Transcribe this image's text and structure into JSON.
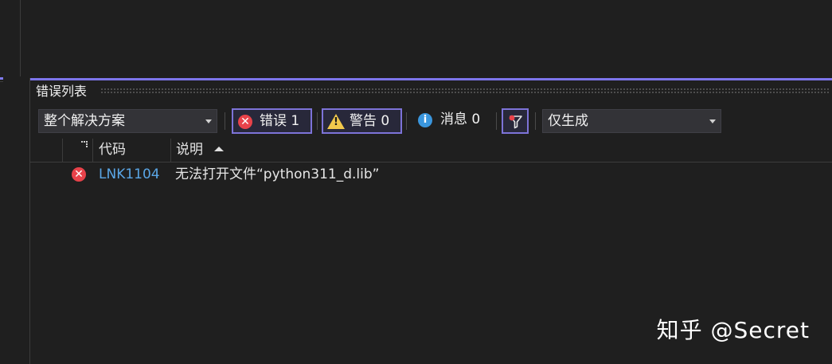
{
  "panel": {
    "title": "错误列表"
  },
  "toolbar": {
    "scope_dropdown": "整个解决方案",
    "errors": {
      "label": "错误",
      "count": "1"
    },
    "warnings": {
      "label": "警告",
      "count": "0"
    },
    "messages": {
      "label": "消息",
      "count": "0"
    },
    "build_dropdown": "仅生成"
  },
  "columns": {
    "code": "代码",
    "description": "说明"
  },
  "rows": [
    {
      "severity": "error-icon",
      "code": "LNK1104",
      "description": "无法打开文件“python311_d.lib”"
    }
  ],
  "watermark": "知乎 @Secret",
  "colors": {
    "accent": "#7d75ea",
    "error": "#e8424a",
    "warning": "#f2c94c",
    "info": "#3a96dd",
    "link": "#5aa6e6",
    "background": "#1f1f1f"
  }
}
